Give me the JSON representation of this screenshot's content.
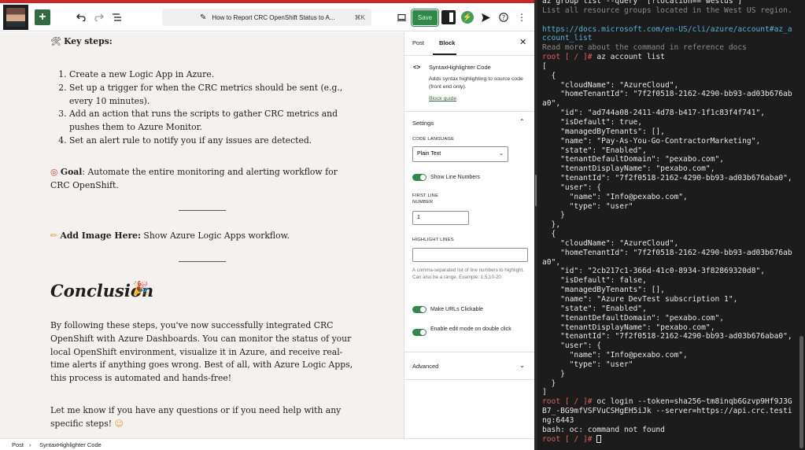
{
  "toolbar": {
    "doc_title": "How to Report CRC OpenShift Status to A...",
    "shortcut": "⌘K",
    "save_label": "Save"
  },
  "content": {
    "key_steps_label": "Key steps:",
    "steps": [
      "Create a new Logic App in Azure.",
      "Set up a trigger for when the CRC metrics should be sent (e.g., every 10 minutes).",
      "Add an action that runs the scripts to gather CRC metrics and pushes them to Azure Monitor.",
      "Set an alert rule to notify you if any issues are detected."
    ],
    "goal_label": "Goal",
    "goal_text": ": Automate the entire monitoring and alerting workflow for CRC OpenShift.",
    "add_image_label": "Add Image Here:",
    "add_image_text": " Show Azure Logic Apps workflow.",
    "conclusion_heading": "Conclusion",
    "conclusion_text": "By following these steps, you've now successfully integrated CRC OpenShift with Azure Dashboards. You can monitor the status of your local OpenShift environment, visualize it in Azure, and receive real-time alerts if anything goes wrong. Best of all, with Azure Logic Apps, this process is automated and hands-free!",
    "closing_text": "Let me know if you have any questions or if you need help with any specific steps!"
  },
  "sidebar": {
    "tab_post": "Post",
    "tab_block": "Block",
    "block_name": "SyntaxHighlighter Code",
    "block_description": "Adds syntax highlighting to source code (front end only).",
    "block_guide": "Block guide",
    "settings_label": "Settings",
    "code_language_label": "CODE LANGUAGE",
    "code_language_value": "Plain Text",
    "show_line_numbers": "Show Line Numbers",
    "first_line_label": "FIRST LINE NUMBER",
    "first_line_value": "1",
    "highlight_lines_label": "HIGHLIGHT LINES",
    "highlight_help": "A comma-separated list of line numbers to highlight. Can also be a range. Example: 1,5,10-20",
    "make_urls_clickable": "Make URLs Clickable",
    "edit_mode_double_click": "Enable edit mode on double click",
    "advanced_label": "Advanced"
  },
  "footer": {
    "crumb_post": "Post",
    "crumb_sep": "›",
    "crumb_block": "SyntaxHighlighter Code"
  },
  "terminal": {
    "lines": [
      {
        "t": "az group list --query \"[?location=='westus']\"",
        "c": ""
      },
      {
        "t": "List all resource groups located in the West US region.",
        "c": "dim"
      },
      {
        "t": "",
        "c": ""
      },
      {
        "t": "https://docs.microsoft.com/en-US/cli/azure/account#az_a",
        "c": "url"
      },
      {
        "t": "ccount_list",
        "c": "url"
      },
      {
        "t": "Read more about the command in reference docs",
        "c": "dim"
      },
      {
        "p": "root [ / ]#",
        "t": " az account list",
        "c": ""
      },
      {
        "t": "[",
        "c": ""
      },
      {
        "t": "  {",
        "c": ""
      },
      {
        "t": "    \"cloudName\": \"AzureCloud\",",
        "c": ""
      },
      {
        "t": "    \"homeTenantId\": \"7f2f0518-2162-4290-bb93-ad03b676ab",
        "c": ""
      },
      {
        "t": "a0\",",
        "c": ""
      },
      {
        "t": "    \"id\": \"ad744a08-2411-4d78-b417-1f1c83f4f741\",",
        "c": ""
      },
      {
        "t": "    \"isDefault\": true,",
        "c": ""
      },
      {
        "t": "    \"managedByTenants\": [],",
        "c": ""
      },
      {
        "t": "    \"name\": \"Pay-As-You-Go-ContractorMarketing\",",
        "c": ""
      },
      {
        "t": "    \"state\": \"Enabled\",",
        "c": ""
      },
      {
        "t": "    \"tenantDefaultDomain\": \"pexabo.com\",",
        "c": ""
      },
      {
        "t": "    \"tenantDisplayName\": \"pexabo.com\",",
        "c": ""
      },
      {
        "t": "    \"tenantId\": \"7f2f0518-2162-4290-bb93-ad03b676aba0\",",
        "c": ""
      },
      {
        "t": "    \"user\": {",
        "c": ""
      },
      {
        "t": "      \"name\": \"Info@pexabo.com\",",
        "c": ""
      },
      {
        "t": "      \"type\": \"user\"",
        "c": ""
      },
      {
        "t": "    }",
        "c": ""
      },
      {
        "t": "  },",
        "c": ""
      },
      {
        "t": "  {",
        "c": ""
      },
      {
        "t": "    \"cloudName\": \"AzureCloud\",",
        "c": ""
      },
      {
        "t": "    \"homeTenantId\": \"7f2f0518-2162-4290-bb93-ad03b676ab",
        "c": ""
      },
      {
        "t": "a0\",",
        "c": ""
      },
      {
        "t": "    \"id\": \"2cb217c1-366d-41c0-8934-3f82869320d8\",",
        "c": ""
      },
      {
        "t": "    \"isDefault\": false,",
        "c": ""
      },
      {
        "t": "    \"managedByTenants\": [],",
        "c": ""
      },
      {
        "t": "    \"name\": \"Azure DevTest subscription 1\",",
        "c": ""
      },
      {
        "t": "    \"state\": \"Enabled\",",
        "c": ""
      },
      {
        "t": "    \"tenantDefaultDomain\": \"pexabo.com\",",
        "c": ""
      },
      {
        "t": "    \"tenantDisplayName\": \"pexabo.com\",",
        "c": ""
      },
      {
        "t": "    \"tenantId\": \"7f2f0518-2162-4290-bb93-ad03b676aba0\",",
        "c": ""
      },
      {
        "t": "    \"user\": {",
        "c": ""
      },
      {
        "t": "      \"name\": \"Info@pexabo.com\",",
        "c": ""
      },
      {
        "t": "      \"type\": \"user\"",
        "c": ""
      },
      {
        "t": "    }",
        "c": ""
      },
      {
        "t": "  }",
        "c": ""
      },
      {
        "t": "]",
        "c": ""
      },
      {
        "p": "root [ / ]#",
        "t": " oc login --token=sha256~tm8inqb6Gzvp9Hf9J3G",
        "c": ""
      },
      {
        "t": "B7_-BG9mfVSFVuCSHgEH5iJk --server=https://api.crc.testi",
        "c": ""
      },
      {
        "t": "ng:6443",
        "c": ""
      },
      {
        "t": "bash: oc: command not found",
        "c": ""
      },
      {
        "p": "root [ / ]#",
        "t": " ",
        "c": "cursor"
      }
    ]
  },
  "colors": {
    "accent_green": "#2f8a4a",
    "prompt_red": "#e65c5c",
    "url_blue": "#4fb3d9"
  }
}
